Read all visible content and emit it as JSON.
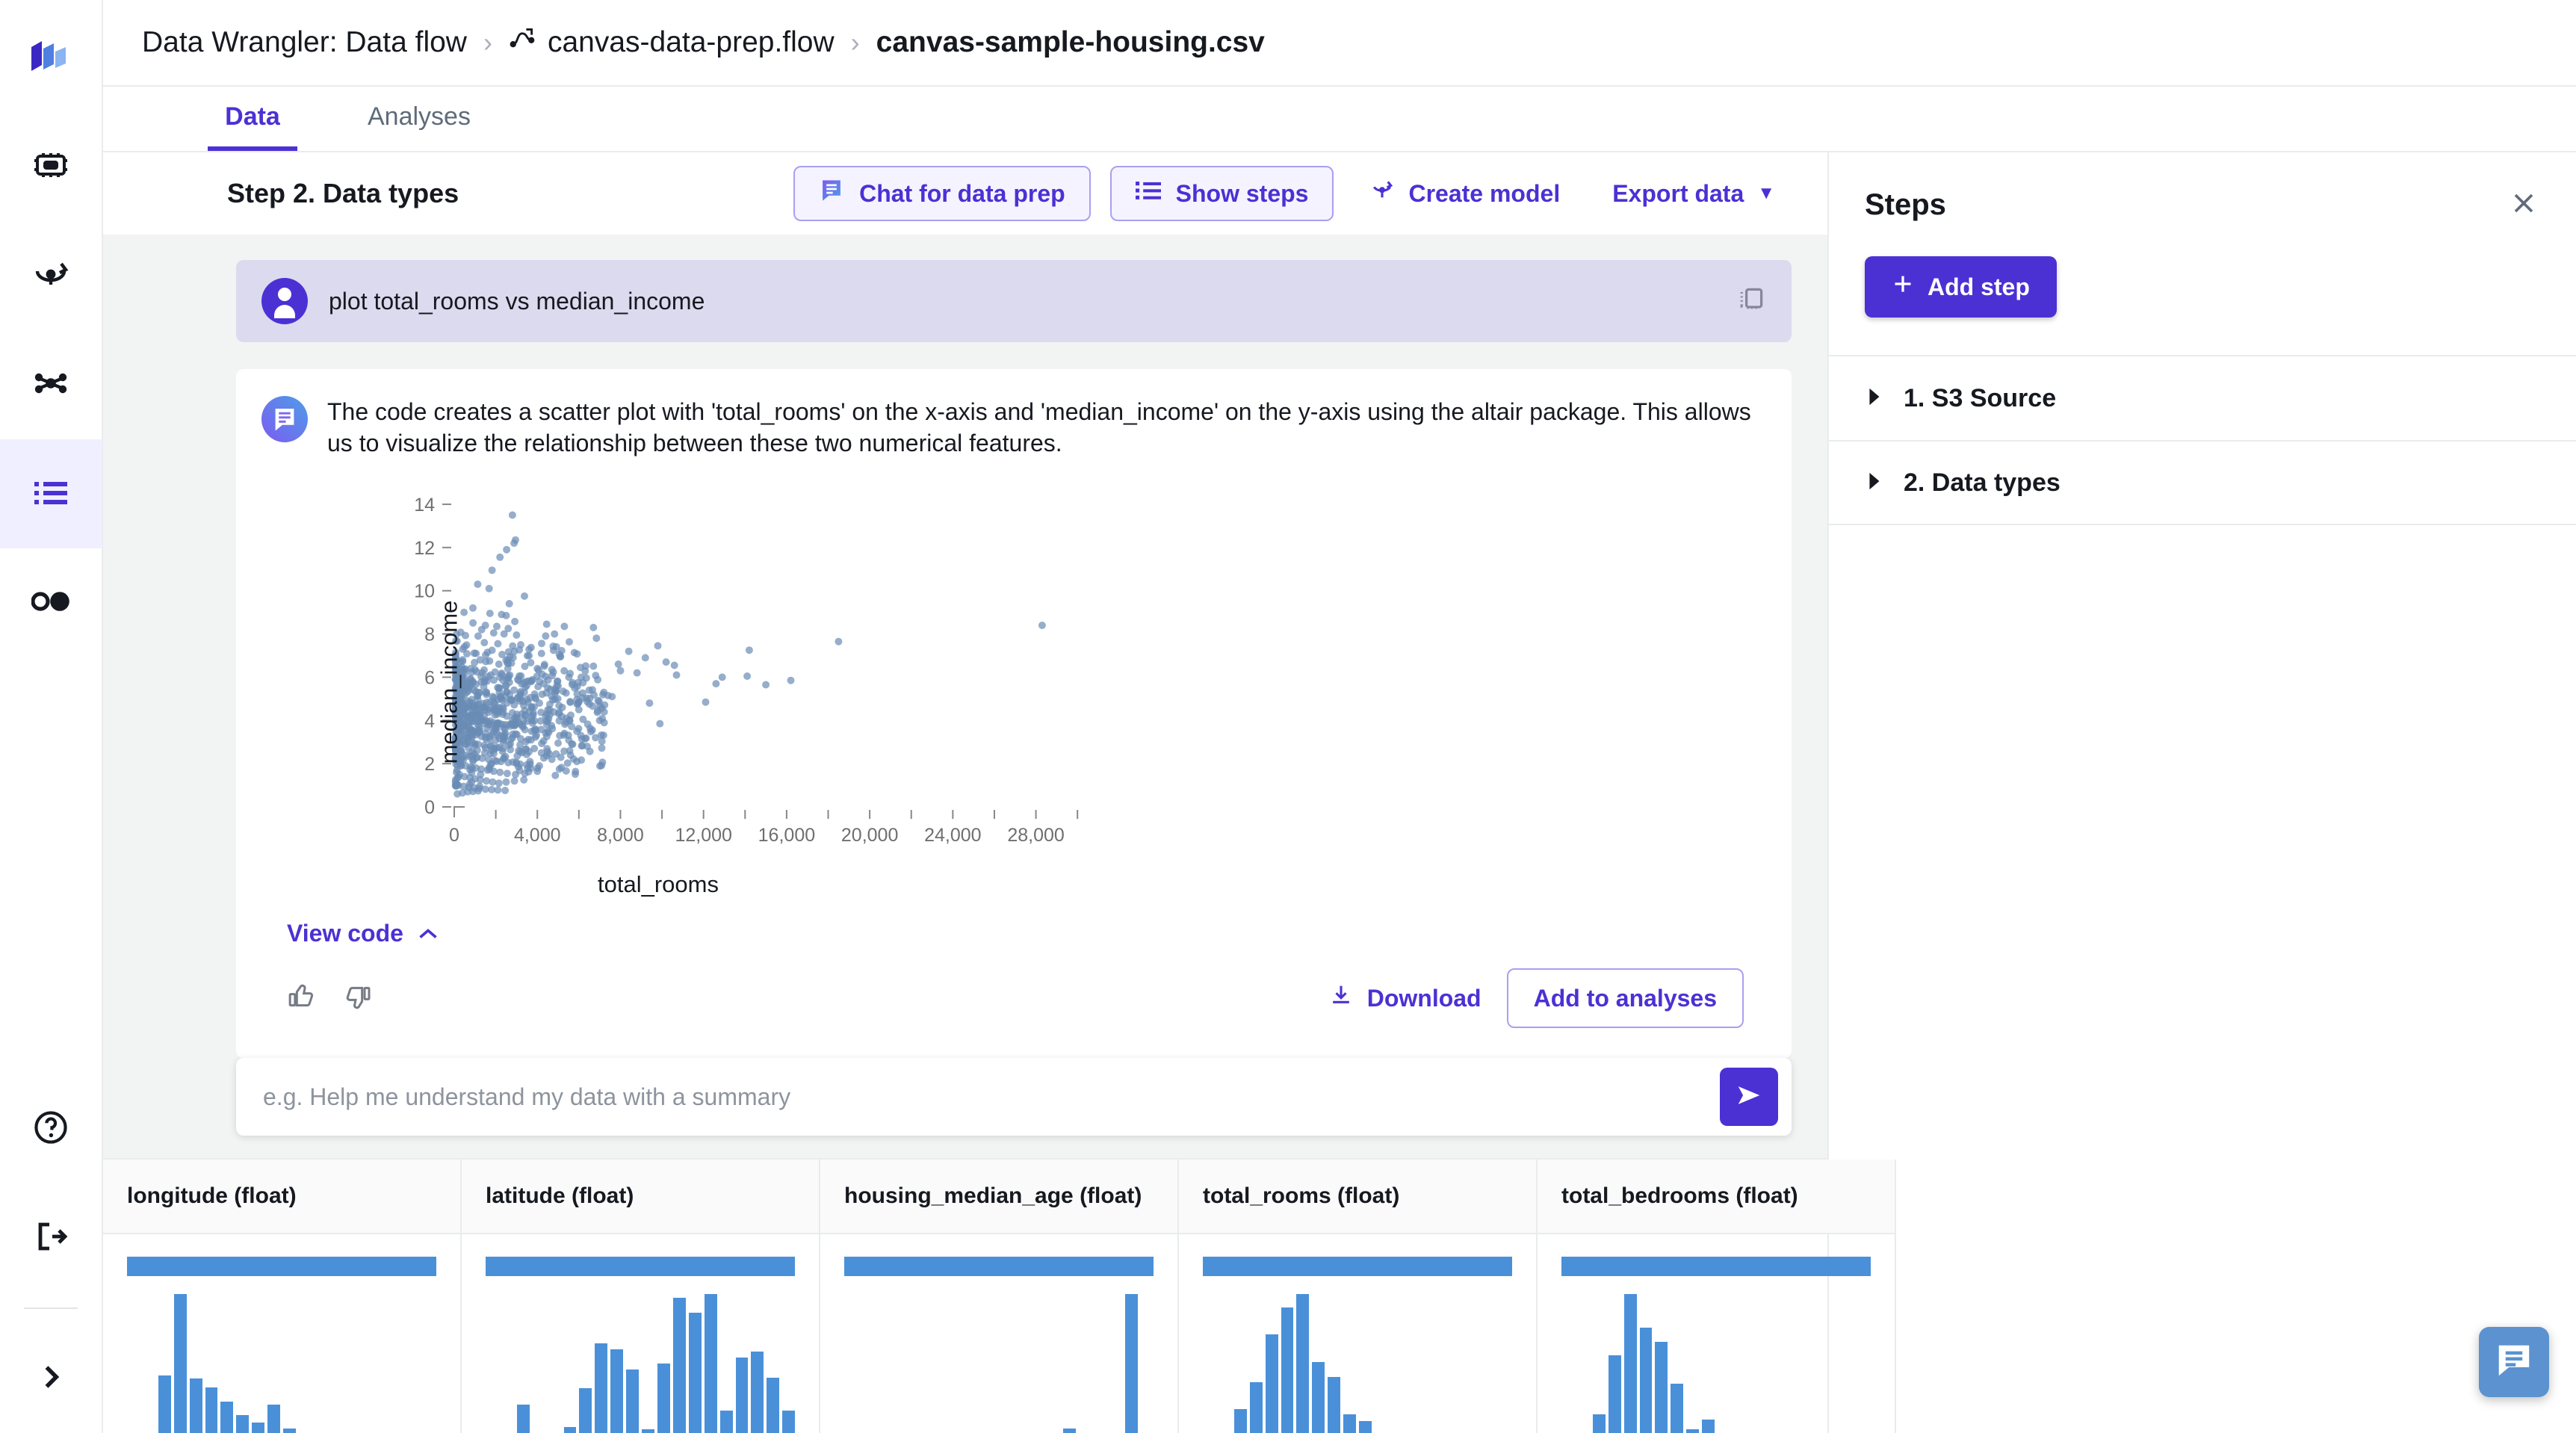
{
  "rail": {
    "logo_icon": "sagemaker-logo-icon",
    "items": [
      {
        "name": "chip-icon",
        "label": "Models"
      },
      {
        "name": "deploy-icon",
        "label": "Deployments"
      },
      {
        "name": "pipeline-icon",
        "label": "Pipelines"
      },
      {
        "name": "data-wrangler-icon",
        "label": "Data Wrangler",
        "active": true
      },
      {
        "name": "toggle-icon",
        "label": "Toggle"
      }
    ],
    "bottom": [
      {
        "name": "help-icon",
        "label": "Help"
      },
      {
        "name": "logout-icon",
        "label": "Sign out"
      },
      {
        "name": "chevron-right-icon",
        "label": "Expand"
      }
    ]
  },
  "breadcrumb": {
    "root": "Data Wrangler: Data flow",
    "sep": "›",
    "flow": "canvas-data-prep.flow",
    "flow_icon": "flow-icon",
    "current": "canvas-sample-housing.csv"
  },
  "tabs": [
    {
      "label": "Data",
      "active": true
    },
    {
      "label": "Analyses",
      "active": false
    }
  ],
  "toolbar": {
    "step_title": "Step 2. Data types",
    "chat_label": "Chat for data prep",
    "chat_icon": "chat-icon",
    "show_steps_label": "Show steps",
    "show_steps_icon": "list-icon",
    "create_model_label": "Create model",
    "create_model_icon": "model-icon",
    "export_label": "Export data",
    "export_caret": "▼"
  },
  "conversation": {
    "user": {
      "avatar": "user-avatar",
      "text": "plot total_rooms vs median_income",
      "copy_icon": "copy-icon"
    },
    "bot": {
      "avatar": "assistant-avatar",
      "text": "The code creates a scatter plot with 'total_rooms' on the x-axis and 'median_income' on the y-axis using the altair package. This allows us to visualize the relationship between these two numerical features.",
      "view_code_label": "View code",
      "view_code_caret": "⌃",
      "thumbs_up_icon": "thumbs-up-icon",
      "thumbs_down_icon": "thumbs-down-icon",
      "download_label": "Download",
      "download_icon": "download-icon",
      "add_to_analyses_label": "Add to analyses"
    }
  },
  "chart_data": {
    "type": "scatter",
    "title": "",
    "xlabel": "total_rooms",
    "ylabel": "median_income",
    "xlim": [
      0,
      31000
    ],
    "ylim": [
      0,
      15
    ],
    "x_ticks": [
      0,
      2000,
      4000,
      6000,
      8000,
      10000,
      12000,
      14000,
      16000,
      18000,
      20000,
      22000,
      24000,
      26000,
      28000,
      30000
    ],
    "x_tick_labels": [
      "0",
      "",
      "4,000",
      "",
      "8,000",
      "",
      "12,000",
      "",
      "16,000",
      "",
      "20,000",
      "",
      "24,000",
      "",
      "28,000",
      ""
    ],
    "y_ticks": [
      0,
      2,
      4,
      6,
      8,
      10,
      12,
      14
    ],
    "y_tick_labels": [
      "0",
      "2",
      "4",
      "6",
      "8",
      "10",
      "12",
      "14"
    ],
    "grid": false,
    "legend": false,
    "point_color": "#6a8cb5",
    "point_opacity": 0.7,
    "point_radius": 5,
    "n_points": 900,
    "points": [
      [
        2800,
        13.5
      ],
      [
        2950,
        12.35
      ],
      [
        2880,
        12.2
      ],
      [
        2520,
        11.9
      ],
      [
        2200,
        11.55
      ],
      [
        1820,
        10.95
      ],
      [
        1130,
        10.3
      ],
      [
        1680,
        10.1
      ],
      [
        3380,
        9.75
      ],
      [
        2650,
        9.4
      ],
      [
        900,
        9.2
      ],
      [
        1720,
        8.95
      ],
      [
        2280,
        8.9
      ],
      [
        2500,
        8.85
      ],
      [
        4450,
        8.45
      ],
      [
        28300,
        8.4
      ],
      [
        1500,
        8.4
      ],
      [
        2050,
        8.35
      ],
      [
        1320,
        8.2
      ],
      [
        2600,
        8.25
      ],
      [
        1900,
        8.05
      ],
      [
        2400,
        8.0
      ],
      [
        1150,
        7.9
      ],
      [
        3000,
        7.95
      ],
      [
        5300,
        8.35
      ],
      [
        6700,
        8.3
      ],
      [
        1450,
        7.6
      ],
      [
        2100,
        7.55
      ],
      [
        3200,
        7.5
      ],
      [
        9800,
        7.45
      ],
      [
        18500,
        7.65
      ],
      [
        14200,
        7.25
      ],
      [
        8400,
        7.2
      ],
      [
        1050,
        7.1
      ],
      [
        1600,
        7.15
      ],
      [
        2300,
        7.05
      ],
      [
        2900,
        7.2
      ],
      [
        3600,
        7.0
      ],
      [
        4200,
        7.1
      ],
      [
        5100,
        6.95
      ],
      [
        9200,
        6.9
      ],
      [
        10200,
        6.7
      ],
      [
        7900,
        6.6
      ],
      [
        10600,
        6.55
      ],
      [
        1250,
        6.8
      ],
      [
        1700,
        6.75
      ],
      [
        2150,
        6.6
      ],
      [
        2750,
        6.65
      ],
      [
        3400,
        6.5
      ],
      [
        4000,
        6.4
      ],
      [
        4700,
        6.35
      ],
      [
        8000,
        6.3
      ],
      [
        8800,
        6.2
      ],
      [
        10700,
        6.1
      ],
      [
        12900,
        6.0
      ],
      [
        14100,
        6.05
      ],
      [
        15000,
        5.65
      ],
      [
        16200,
        5.85
      ],
      [
        12600,
        5.7
      ],
      [
        800,
        6.4
      ],
      [
        1000,
        6.35
      ],
      [
        1350,
        6.2
      ],
      [
        1750,
        6.1
      ],
      [
        2200,
        6.0
      ],
      [
        2600,
        5.95
      ],
      [
        3100,
        5.85
      ],
      [
        3700,
        5.8
      ],
      [
        4300,
        5.7
      ],
      [
        5000,
        5.6
      ],
      [
        5800,
        5.5
      ],
      [
        6500,
        5.4
      ],
      [
        7200,
        5.3
      ],
      [
        12100,
        4.85
      ],
      [
        9400,
        4.8
      ],
      [
        700,
        5.5
      ],
      [
        950,
        5.4
      ],
      [
        1200,
        5.3
      ],
      [
        1550,
        5.2
      ],
      [
        1850,
        5.1
      ],
      [
        2250,
        5.0
      ],
      [
        2700,
        4.95
      ],
      [
        3150,
        4.9
      ],
      [
        3550,
        4.85
      ],
      [
        4100,
        4.8
      ],
      [
        4600,
        4.75
      ],
      [
        5200,
        4.6
      ],
      [
        6000,
        4.5
      ],
      [
        6900,
        4.45
      ],
      [
        7600,
        5.1
      ],
      [
        7400,
        5.15
      ],
      [
        600,
        4.9
      ],
      [
        850,
        4.8
      ],
      [
        1100,
        4.7
      ],
      [
        1400,
        4.6
      ],
      [
        1650,
        4.5
      ],
      [
        1950,
        4.45
      ],
      [
        2350,
        4.4
      ],
      [
        2800,
        4.35
      ],
      [
        3250,
        4.3
      ],
      [
        3800,
        4.25
      ],
      [
        4400,
        4.2
      ],
      [
        5400,
        4.1
      ],
      [
        6200,
        4.05
      ],
      [
        7000,
        4.0
      ],
      [
        9900,
        3.85
      ],
      [
        500,
        4.3
      ],
      [
        750,
        4.2
      ],
      [
        1000,
        4.1
      ],
      [
        1300,
        4.0
      ],
      [
        1600,
        3.95
      ],
      [
        1900,
        3.9
      ],
      [
        2200,
        3.85
      ],
      [
        2500,
        3.8
      ],
      [
        2900,
        3.75
      ],
      [
        3300,
        3.7
      ],
      [
        3900,
        3.6
      ],
      [
        4500,
        3.5
      ],
      [
        5300,
        3.4
      ],
      [
        6100,
        3.3
      ],
      [
        6800,
        3.2
      ],
      [
        450,
        3.7
      ],
      [
        700,
        3.6
      ],
      [
        950,
        3.5
      ],
      [
        1200,
        3.45
      ],
      [
        1500,
        3.4
      ],
      [
        1800,
        3.35
      ],
      [
        2100,
        3.3
      ],
      [
        2400,
        3.25
      ],
      [
        2800,
        3.2
      ],
      [
        3200,
        3.15
      ],
      [
        3700,
        3.1
      ],
      [
        4300,
        3.05
      ],
      [
        5000,
        2.95
      ],
      [
        5700,
        2.9
      ],
      [
        6400,
        2.8
      ],
      [
        400,
        3.1
      ],
      [
        650,
        3.0
      ],
      [
        900,
        2.95
      ],
      [
        1150,
        2.9
      ],
      [
        1450,
        2.85
      ],
      [
        1750,
        2.8
      ],
      [
        2050,
        2.75
      ],
      [
        2350,
        2.7
      ],
      [
        2700,
        2.65
      ],
      [
        3100,
        2.6
      ],
      [
        3600,
        2.55
      ],
      [
        4200,
        2.5
      ],
      [
        4900,
        2.45
      ],
      [
        5600,
        2.4
      ],
      [
        350,
        2.5
      ],
      [
        600,
        2.4
      ],
      [
        850,
        2.35
      ],
      [
        1100,
        2.3
      ],
      [
        1350,
        2.25
      ],
      [
        1650,
        2.2
      ],
      [
        1950,
        2.15
      ],
      [
        2250,
        2.1
      ],
      [
        2600,
        2.05
      ],
      [
        3000,
        2.0
      ],
      [
        3500,
        1.95
      ],
      [
        4100,
        1.9
      ],
      [
        4700,
        2.2
      ],
      [
        5900,
        2.1
      ],
      [
        300,
        2.0
      ],
      [
        550,
        1.9
      ],
      [
        800,
        1.85
      ],
      [
        1050,
        1.8
      ],
      [
        1300,
        1.75
      ],
      [
        1600,
        1.7
      ],
      [
        1900,
        1.65
      ],
      [
        2200,
        1.6
      ],
      [
        2550,
        1.55
      ],
      [
        2950,
        1.5
      ],
      [
        3400,
        1.55
      ],
      [
        4000,
        1.65
      ],
      [
        250,
        1.5
      ],
      [
        500,
        1.4
      ],
      [
        750,
        1.35
      ],
      [
        1000,
        1.3
      ],
      [
        1250,
        1.25
      ],
      [
        1550,
        1.2
      ],
      [
        1850,
        1.15
      ],
      [
        2150,
        1.1
      ],
      [
        2500,
        1.15
      ],
      [
        2900,
        1.2
      ],
      [
        3350,
        1.25
      ],
      [
        200,
        1.0
      ],
      [
        450,
        0.95
      ],
      [
        700,
        0.9
      ],
      [
        950,
        0.88
      ],
      [
        1200,
        0.85
      ],
      [
        1500,
        0.82
      ],
      [
        1800,
        0.8
      ],
      [
        2100,
        0.78
      ],
      [
        2450,
        0.76
      ],
      [
        150,
        0.6
      ],
      [
        400,
        0.65
      ],
      [
        650,
        0.7
      ],
      [
        900,
        0.72
      ],
      [
        1150,
        0.74
      ]
    ]
  },
  "prompt": {
    "value": "",
    "placeholder": "e.g. Help me understand my data with a summary",
    "send_icon": "send-icon"
  },
  "grid": {
    "columns": [
      {
        "header": "longitude (float)",
        "hist": [
          0,
          0,
          38,
          92,
          36,
          30,
          21,
          12,
          7,
          19,
          3,
          0,
          0,
          0,
          0,
          0,
          0,
          0,
          0,
          0
        ]
      },
      {
        "header": "latitude (float)",
        "hist": [
          0,
          0,
          14,
          0,
          0,
          3,
          22,
          44,
          41,
          31,
          2,
          34,
          66,
          59,
          68,
          11,
          37,
          40,
          27,
          11
        ]
      },
      {
        "header": "housing_median_age (float)",
        "hist": [
          0,
          0,
          0,
          0,
          0,
          0,
          0,
          0,
          0,
          0,
          0,
          0,
          0,
          0,
          3,
          0,
          0,
          0,
          96,
          0
        ]
      },
      {
        "header": "total_rooms (float)",
        "hist": [
          0,
          0,
          14,
          30,
          58,
          74,
          82,
          42,
          33,
          11,
          7,
          0,
          0,
          0,
          0,
          0,
          0,
          0,
          0,
          0
        ]
      },
      {
        "header": "total_bedrooms (float)",
        "hist": [
          0,
          0,
          11,
          46,
          82,
          62,
          54,
          29,
          2,
          8,
          0,
          0,
          0,
          0,
          0,
          0,
          0,
          0,
          0,
          0
        ]
      }
    ]
  },
  "steps_panel": {
    "title": "Steps",
    "close_icon": "close-icon",
    "add_step_label": "Add step",
    "add_step_icon": "plus-icon",
    "items": [
      {
        "label": "1. S3 Source",
        "caret": "caret-right-icon"
      },
      {
        "label": "2. Data types",
        "caret": "caret-right-icon"
      }
    ]
  },
  "chat_fab": {
    "icon": "chat-bubble-icon"
  },
  "colors": {
    "accent": "#4b31d4",
    "accent_soft": "#f5f3ff",
    "scatter": "#6a8cb5",
    "histogram": "#4a90d9",
    "panel_bg": "#f2f3f3",
    "fab": "#5b92cf"
  }
}
